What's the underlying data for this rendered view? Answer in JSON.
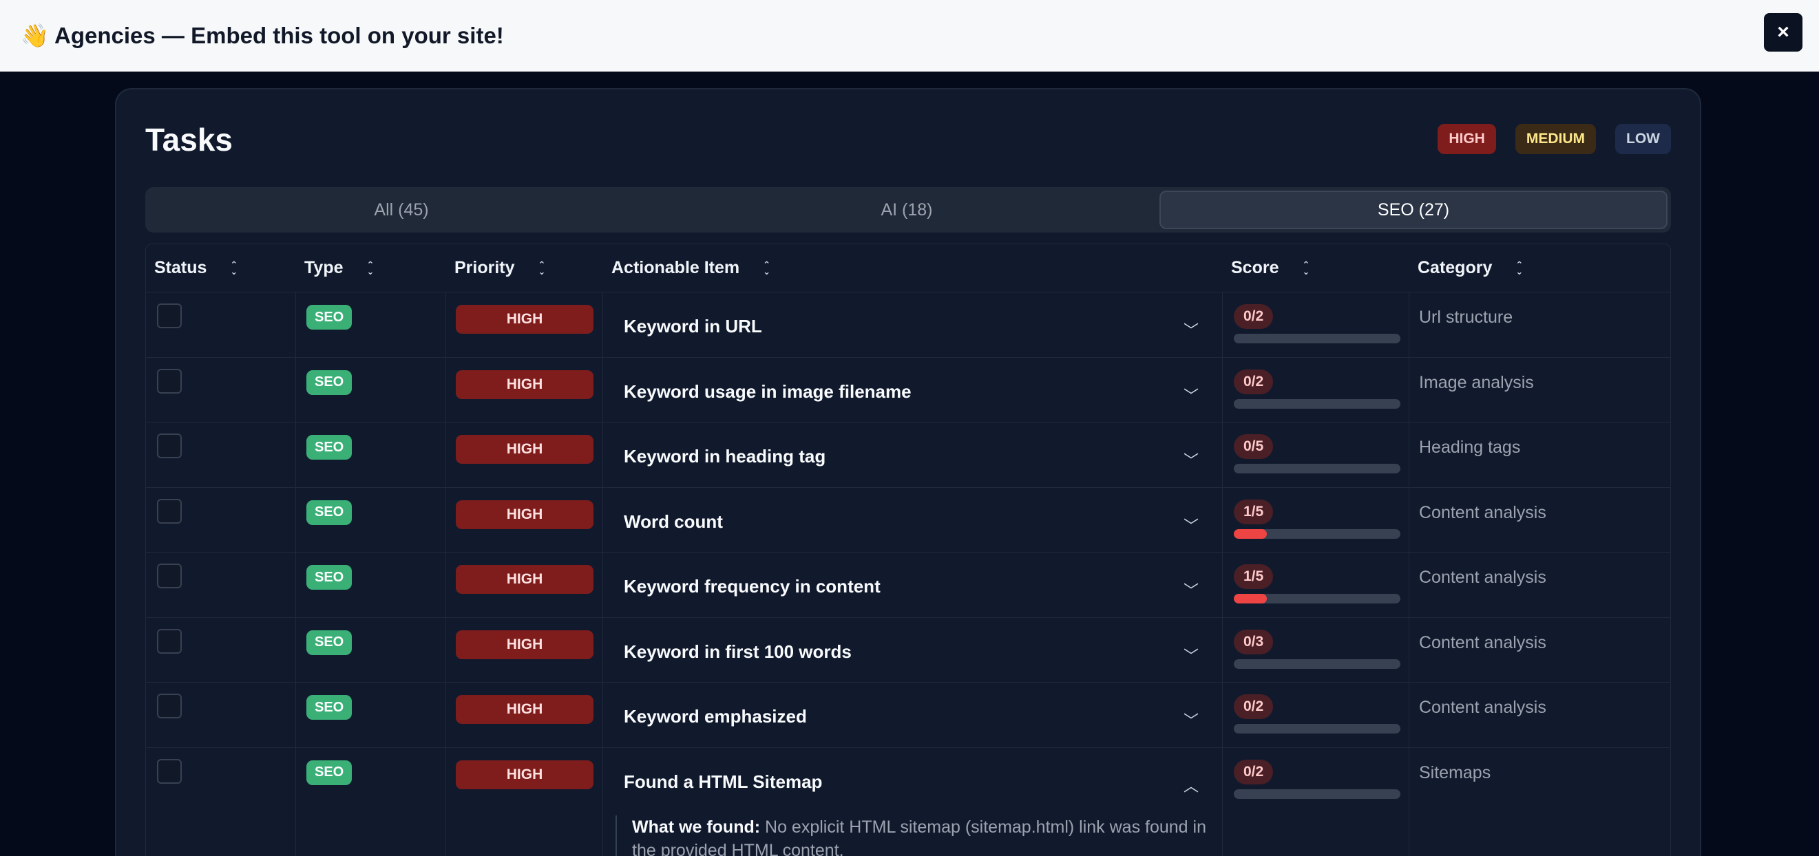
{
  "banner": {
    "text": "👋 Agencies — Embed this tool on your site!",
    "close_label": "×"
  },
  "card": {
    "title": "Tasks",
    "legend": [
      "HIGH",
      "MEDIUM",
      "LOW"
    ]
  },
  "tabs": [
    {
      "label": "All (45)",
      "active": false
    },
    {
      "label": "AI (18)",
      "active": false
    },
    {
      "label": "SEO (27)",
      "active": true
    }
  ],
  "table": {
    "headers": [
      "Status",
      "Type",
      "Priority",
      "Actionable Item",
      "Score",
      "Category"
    ],
    "rows": [
      {
        "type": "SEO",
        "priority": "HIGH",
        "item": "Keyword in URL",
        "score": "0/2",
        "score_fraction": 0.0,
        "category": "Url structure"
      },
      {
        "type": "SEO",
        "priority": "HIGH",
        "item": "Keyword usage in image filename",
        "score": "0/2",
        "score_fraction": 0.0,
        "category": "Image analysis"
      },
      {
        "type": "SEO",
        "priority": "HIGH",
        "item": "Keyword in heading tag",
        "score": "0/5",
        "score_fraction": 0.0,
        "category": "Heading tags"
      },
      {
        "type": "SEO",
        "priority": "HIGH",
        "item": "Word count",
        "score": "1/5",
        "score_fraction": 0.2,
        "category": "Content analysis"
      },
      {
        "type": "SEO",
        "priority": "HIGH",
        "item": "Keyword frequency in content",
        "score": "1/5",
        "score_fraction": 0.2,
        "category": "Content analysis"
      },
      {
        "type": "SEO",
        "priority": "HIGH",
        "item": "Keyword in first 100 words",
        "score": "0/3",
        "score_fraction": 0.0,
        "category": "Content analysis"
      },
      {
        "type": "SEO",
        "priority": "HIGH",
        "item": "Keyword emphasized",
        "score": "0/2",
        "score_fraction": 0.0,
        "category": "Content analysis"
      },
      {
        "type": "SEO",
        "priority": "HIGH",
        "item": "Found a HTML Sitemap",
        "score": "0/2",
        "score_fraction": 0.0,
        "category": "Sitemaps",
        "expanded": true,
        "details_label": "What we found:",
        "details_text": "No explicit HTML sitemap (sitemap.html) link was found in the provided HTML content."
      }
    ]
  },
  "colors": {
    "accent_high": "#7f1d1d",
    "seo_badge": "#3ab077",
    "score_fill": "#ef4444"
  }
}
